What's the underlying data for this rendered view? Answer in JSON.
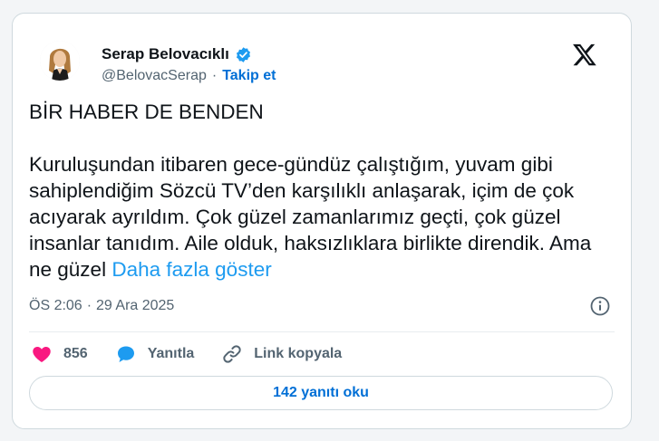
{
  "author": {
    "name": "Serap Belovacıklı",
    "handle": "@BelovacSerap",
    "separator": "·",
    "follow_label": "Takip et"
  },
  "tweet": {
    "headline": "BİR HABER DE BENDEN",
    "body": "Kuruluşundan itibaren gece-gündüz çalıştığım, yuvam gibi sahiplendiğim Sözcü TV’den karşılıklı anlaşarak, içim de çok acıyarak ayrıldım. Çok güzel zamanlarımız geçti, çok güzel insanlar tanıdım. Aile olduk, haksızlıklara birlikte direndik. Ama ne güzel",
    "show_more_label": "Daha fazla göster",
    "time": "ÖS 2:06",
    "date": "29 Ara 2025",
    "meta_separator": "·"
  },
  "actions": {
    "like_count": "856",
    "reply_label": "Yanıtla",
    "copy_link_label": "Link kopyala"
  },
  "replies_button_label": "142 yanıtı oku",
  "colors": {
    "link_blue": "#1d9bf0",
    "follow_blue": "#006fd6",
    "like_pink": "#f91880",
    "reply_blue": "#1d9bf0",
    "muted_text": "#536471",
    "border": "#cfd9de"
  },
  "icons": {
    "verified": "verified-badge-icon",
    "brand": "x-logo-icon",
    "info": "info-icon",
    "like": "heart-icon",
    "reply": "speech-bubble-icon",
    "copy_link": "link-icon"
  }
}
